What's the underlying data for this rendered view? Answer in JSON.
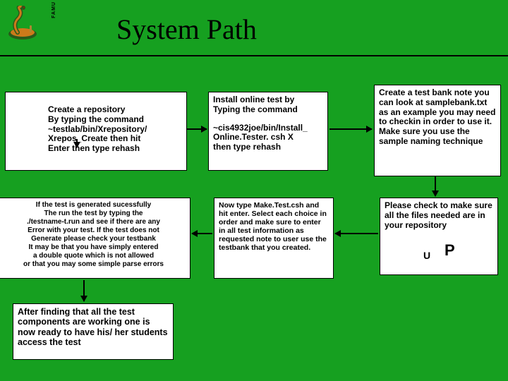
{
  "logo": {
    "text": "FAMU"
  },
  "title": "System Path",
  "boxes": {
    "b1": "Create a repository\nBy typing the command\n~testlab/bin/Xrepository/\nXrepos_Create then hit\nEnter then type rehash",
    "b2_l1": "Install online test by\nTyping the command",
    "b2_l2": "~cis4932joe/bin/Install_\nOnline.Tester. csh   X\nthen type rehash",
    "b3": "Create a test bank note you can look at samplebank.txt as an example you may need to checkin in order to use it. Make sure you use the sample naming technique",
    "b4": "If the test is generated sucessfully\nThe run the test by typing the\n./testname-t.run and see if there are any\nError with your test. If the test does not\nGenerate please check your testbank\nIt may be that you have simply entered\na double quote which is not allowed\nor that you may  some simple parse errors",
    "b5": "Now type Make.Test.csh and hit enter.  Select each choice in order and make sure to enter in all test information as requested note to user use the testbank that you created.",
    "b6": "Please check to make sure all the files needed are in your repository",
    "b7": "After finding that all the test components are working one is now ready to have his/ her students access the test"
  },
  "letters": {
    "u": "U",
    "p": "P"
  }
}
